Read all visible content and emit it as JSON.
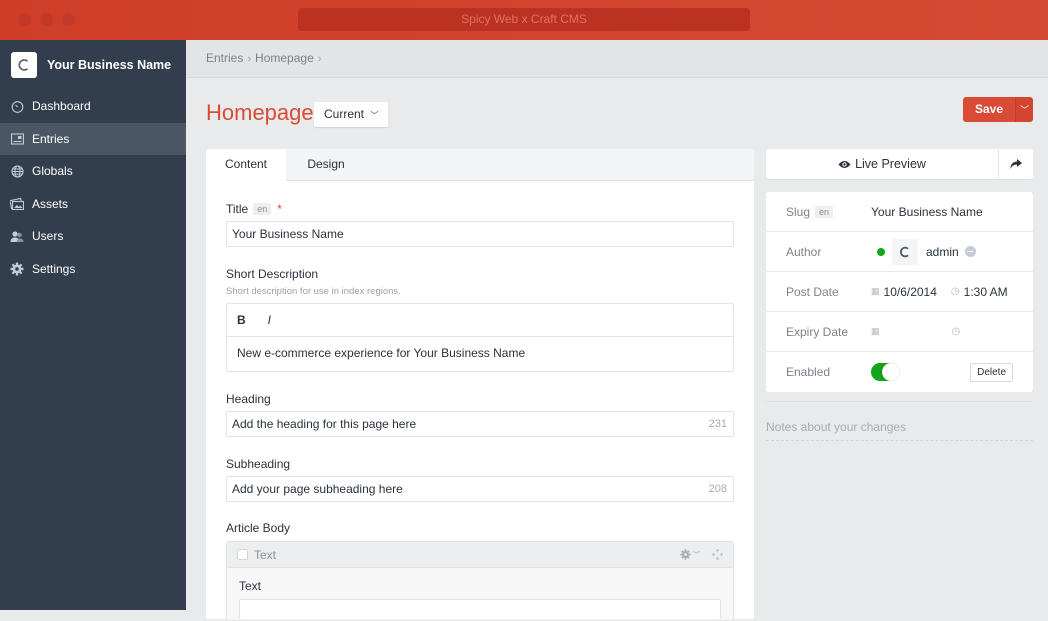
{
  "window": {
    "title": "Spicy Web x Craft CMS"
  },
  "sidebar": {
    "brand": "Your Business Name",
    "items": [
      {
        "label": "Dashboard",
        "icon": "dashboard-icon",
        "active": false
      },
      {
        "label": "Entries",
        "icon": "entries-icon",
        "active": true
      },
      {
        "label": "Globals",
        "icon": "globe-icon",
        "active": false
      },
      {
        "label": "Assets",
        "icon": "assets-icon",
        "active": false
      },
      {
        "label": "Users",
        "icon": "users-icon",
        "active": false
      },
      {
        "label": "Settings",
        "icon": "gear-icon",
        "active": false
      }
    ]
  },
  "breadcrumb": [
    "Entries",
    "Homepage"
  ],
  "header": {
    "title": "Homepage",
    "revision": "Current",
    "save_label": "Save"
  },
  "tabs": [
    {
      "label": "Content"
    },
    {
      "label": "Design"
    }
  ],
  "fields": {
    "title": {
      "label": "Title",
      "locale": "en",
      "value": "Your Business Name"
    },
    "short_description": {
      "label": "Short Description",
      "hint": "Short description for use in index regions.",
      "bold": "B",
      "italic": "I",
      "value": "New e-commerce experience for Your Business Name"
    },
    "heading": {
      "label": "Heading",
      "value": "Add the heading for this page here",
      "remaining": "231"
    },
    "subheading": {
      "label": "Subheading",
      "value": "Add your page subheading here",
      "remaining": "208"
    },
    "article_body": {
      "label": "Article Body",
      "block_type": "Text",
      "block_field_label": "Text"
    }
  },
  "side": {
    "live_preview": "Live Preview",
    "slug": {
      "label": "Slug",
      "locale": "en",
      "value": "Your Business Name"
    },
    "author": {
      "label": "Author",
      "value": "admin"
    },
    "post_date": {
      "label": "Post Date",
      "date": "10/6/2014",
      "time": "1:30 AM"
    },
    "expiry_date": {
      "label": "Expiry Date"
    },
    "enabled": {
      "label": "Enabled",
      "value": true
    },
    "delete_label": "Delete",
    "notes_placeholder": "Notes about your changes"
  },
  "colors": {
    "accent": "#da4b37",
    "sidebar": "#323e4e",
    "enabled": "#13a51a"
  }
}
